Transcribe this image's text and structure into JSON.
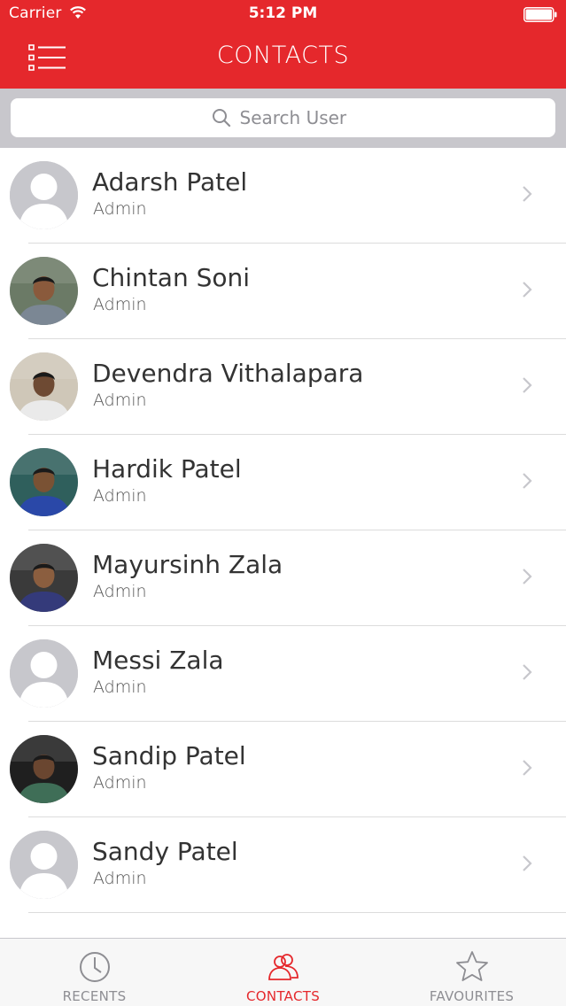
{
  "status_bar": {
    "carrier": "Carrier",
    "time": "5:12 PM"
  },
  "nav": {
    "title": "CONTACTS",
    "menu_icon": "list-menu-icon"
  },
  "search": {
    "placeholder": "Search User",
    "icon": "search-icon"
  },
  "contacts": [
    {
      "name": "Adarsh Patel",
      "role": "Admin",
      "photo": "placeholder"
    },
    {
      "name": "Chintan Soni",
      "role": "Admin",
      "photo": "photo"
    },
    {
      "name": "Devendra Vithalapara",
      "role": "Admin",
      "photo": "photo"
    },
    {
      "name": "Hardik Patel",
      "role": "Admin",
      "photo": "photo"
    },
    {
      "name": "Mayursinh Zala",
      "role": "Admin",
      "photo": "photo"
    },
    {
      "name": "Messi Zala",
      "role": "Admin",
      "photo": "placeholder"
    },
    {
      "name": "Sandip Patel",
      "role": "Admin",
      "photo": "photo"
    },
    {
      "name": "Sandy Patel",
      "role": "Admin",
      "photo": "placeholder"
    }
  ],
  "tabs": [
    {
      "label": "RECENTS",
      "icon": "clock-icon",
      "active": false
    },
    {
      "label": "CONTACTS",
      "icon": "people-icon",
      "active": true
    },
    {
      "label": "FAVOURITES",
      "icon": "star-icon",
      "active": false
    }
  ],
  "colors": {
    "brand": "#e5282c",
    "inactive_tab": "#8e8e93",
    "search_bg": "#c8c7cc"
  }
}
